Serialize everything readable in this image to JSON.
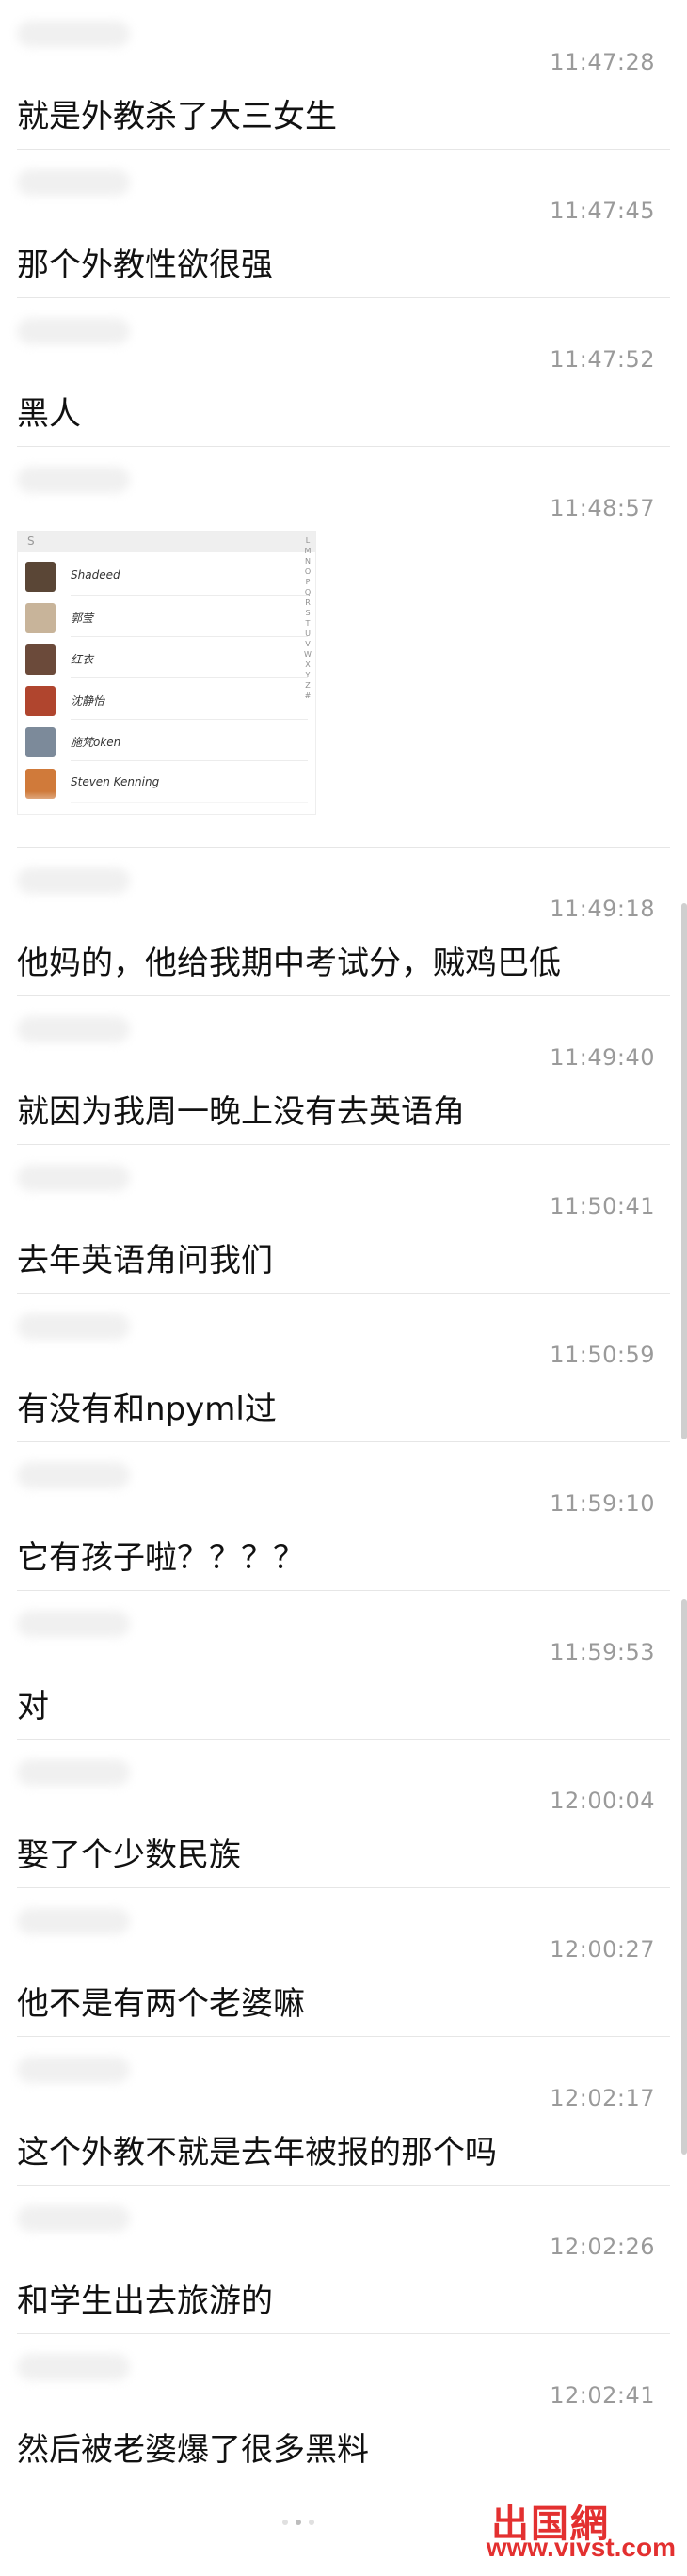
{
  "messages": [
    {
      "time": "11:47:28",
      "text": "就是外教杀了大三女生"
    },
    {
      "time": "11:47:45",
      "text": "那个外教性欲很强"
    },
    {
      "time": "11:47:52",
      "text": "黑人"
    },
    {
      "time": "11:48:57",
      "text": "",
      "image": true
    },
    {
      "time": "11:49:18",
      "text": "他妈的，他给我期中考试分，贼鸡巴低"
    },
    {
      "time": "11:49:40",
      "text": "就因为我周一晚上没有去英语角"
    },
    {
      "time": "11:50:41",
      "text": "去年英语角问我们"
    },
    {
      "time": "11:50:59",
      "text": "有没有和npyml过"
    },
    {
      "time": "11:59:10",
      "text": "它有孩子啦？？？？"
    },
    {
      "time": "11:59:53",
      "text": "对"
    },
    {
      "time": "12:00:04",
      "text": "娶了个少数民族"
    },
    {
      "time": "12:00:27",
      "text": "他不是有两个老婆嘛"
    },
    {
      "time": "12:02:17",
      "text": "这个外教不就是去年被报的那个吗"
    },
    {
      "time": "12:02:26",
      "text": "和学生出去旅游的"
    },
    {
      "time": "12:02:41",
      "text": "然后被老婆爆了很多黑料"
    }
  ],
  "embedded_screenshot": {
    "search_glyph": "S",
    "contacts": [
      {
        "name": "Shadeed",
        "color": "#5a4636"
      },
      {
        "name": "郭莹",
        "color": "#c8b49a"
      },
      {
        "name": "红衣",
        "color": "#6b4a3a"
      },
      {
        "name": "沈静怡",
        "color": "#b0452e"
      },
      {
        "name": "施梵oken",
        "color": "#7c8a9a"
      },
      {
        "name": "Steven Kenning",
        "color": "#d07a3a"
      }
    ],
    "alpha_index": "L M N O P Q R S T U V W X Y Z #"
  },
  "watermark": {
    "brand": "出国網",
    "site": "www.vivst.com"
  }
}
